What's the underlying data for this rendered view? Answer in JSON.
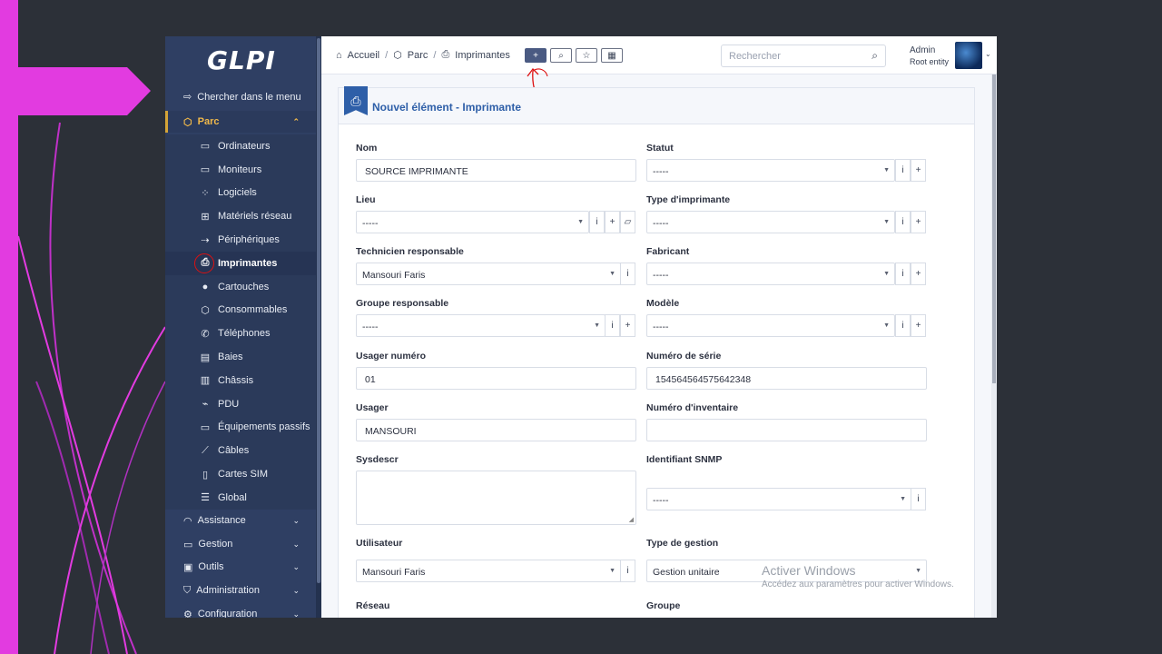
{
  "app": {
    "logo": "GLPI"
  },
  "sidebar": {
    "search_label": "Chercher dans le menu",
    "parc_label": "Parc",
    "items": [
      {
        "label": "Ordinateurs",
        "icon": "laptop-icon"
      },
      {
        "label": "Moniteurs",
        "icon": "monitor-icon"
      },
      {
        "label": "Logiciels",
        "icon": "apps-icon"
      },
      {
        "label": "Matériels réseau",
        "icon": "network-icon"
      },
      {
        "label": "Périphériques",
        "icon": "usb-icon"
      },
      {
        "label": "Imprimantes",
        "icon": "printer-icon"
      },
      {
        "label": "Cartouches",
        "icon": "droplet-icon"
      },
      {
        "label": "Consommables",
        "icon": "box-icon"
      },
      {
        "label": "Téléphones",
        "icon": "phone-icon"
      },
      {
        "label": "Baies",
        "icon": "server-icon"
      },
      {
        "label": "Châssis",
        "icon": "chassis-icon"
      },
      {
        "label": "PDU",
        "icon": "plug-icon"
      },
      {
        "label": "Équipements passifs",
        "icon": "passive-icon"
      },
      {
        "label": "Câbles",
        "icon": "cable-icon"
      },
      {
        "label": "Cartes SIM",
        "icon": "sim-icon"
      },
      {
        "label": "Global",
        "icon": "list-icon"
      }
    ],
    "groups": [
      {
        "label": "Assistance",
        "icon": "headset-icon"
      },
      {
        "label": "Gestion",
        "icon": "wallet-icon"
      },
      {
        "label": "Outils",
        "icon": "briefcase-icon"
      },
      {
        "label": "Administration",
        "icon": "shield-icon"
      },
      {
        "label": "Configuration",
        "icon": "gear-icon"
      }
    ]
  },
  "header": {
    "breadcrumb": [
      "Accueil",
      "Parc",
      "Imprimantes"
    ],
    "search_placeholder": "Rechercher",
    "user_name": "Admin",
    "user_entity": "Root entity"
  },
  "form": {
    "title": "Nouvel élément - Imprimante",
    "fields": {
      "nom": {
        "label": "Nom",
        "value": "SOURCE IMPRIMANTE"
      },
      "statut": {
        "label": "Statut",
        "value": "-----"
      },
      "lieu": {
        "label": "Lieu",
        "value": "-----"
      },
      "type": {
        "label": "Type d'imprimante",
        "value": "-----"
      },
      "technicien": {
        "label": "Technicien responsable",
        "value": "Mansouri Faris"
      },
      "fabricant": {
        "label": "Fabricant",
        "value": "-----"
      },
      "groupe_resp": {
        "label": "Groupe responsable",
        "value": "-----"
      },
      "modele": {
        "label": "Modèle",
        "value": "-----"
      },
      "usager_num": {
        "label": "Usager numéro",
        "value": "01"
      },
      "serie": {
        "label": "Numéro de série",
        "value": "154564564575642348"
      },
      "usager": {
        "label": "Usager",
        "value": "MANSOURI"
      },
      "inventaire": {
        "label": "Numéro d'inventaire",
        "value": ""
      },
      "sysdescr": {
        "label": "Sysdescr",
        "value": ""
      },
      "snmp": {
        "label": "Identifiant SNMP",
        "value": "-----"
      },
      "utilisateur": {
        "label": "Utilisateur",
        "value": "Mansouri Faris"
      },
      "gestion": {
        "label": "Type de gestion",
        "value": "Gestion unitaire"
      },
      "reseau": {
        "label": "Réseau"
      },
      "groupe": {
        "label": "Groupe"
      }
    }
  },
  "watermark": {
    "line1": "Activer Windows",
    "line2": "Accédez aux paramètres pour activer Windows."
  },
  "colors": {
    "sidebar": "#2f3f63",
    "accent": "#2e5fa8",
    "active_menu": "#f0b84a",
    "annotation": "#dd1111",
    "slide_deco": "#e23be0"
  }
}
